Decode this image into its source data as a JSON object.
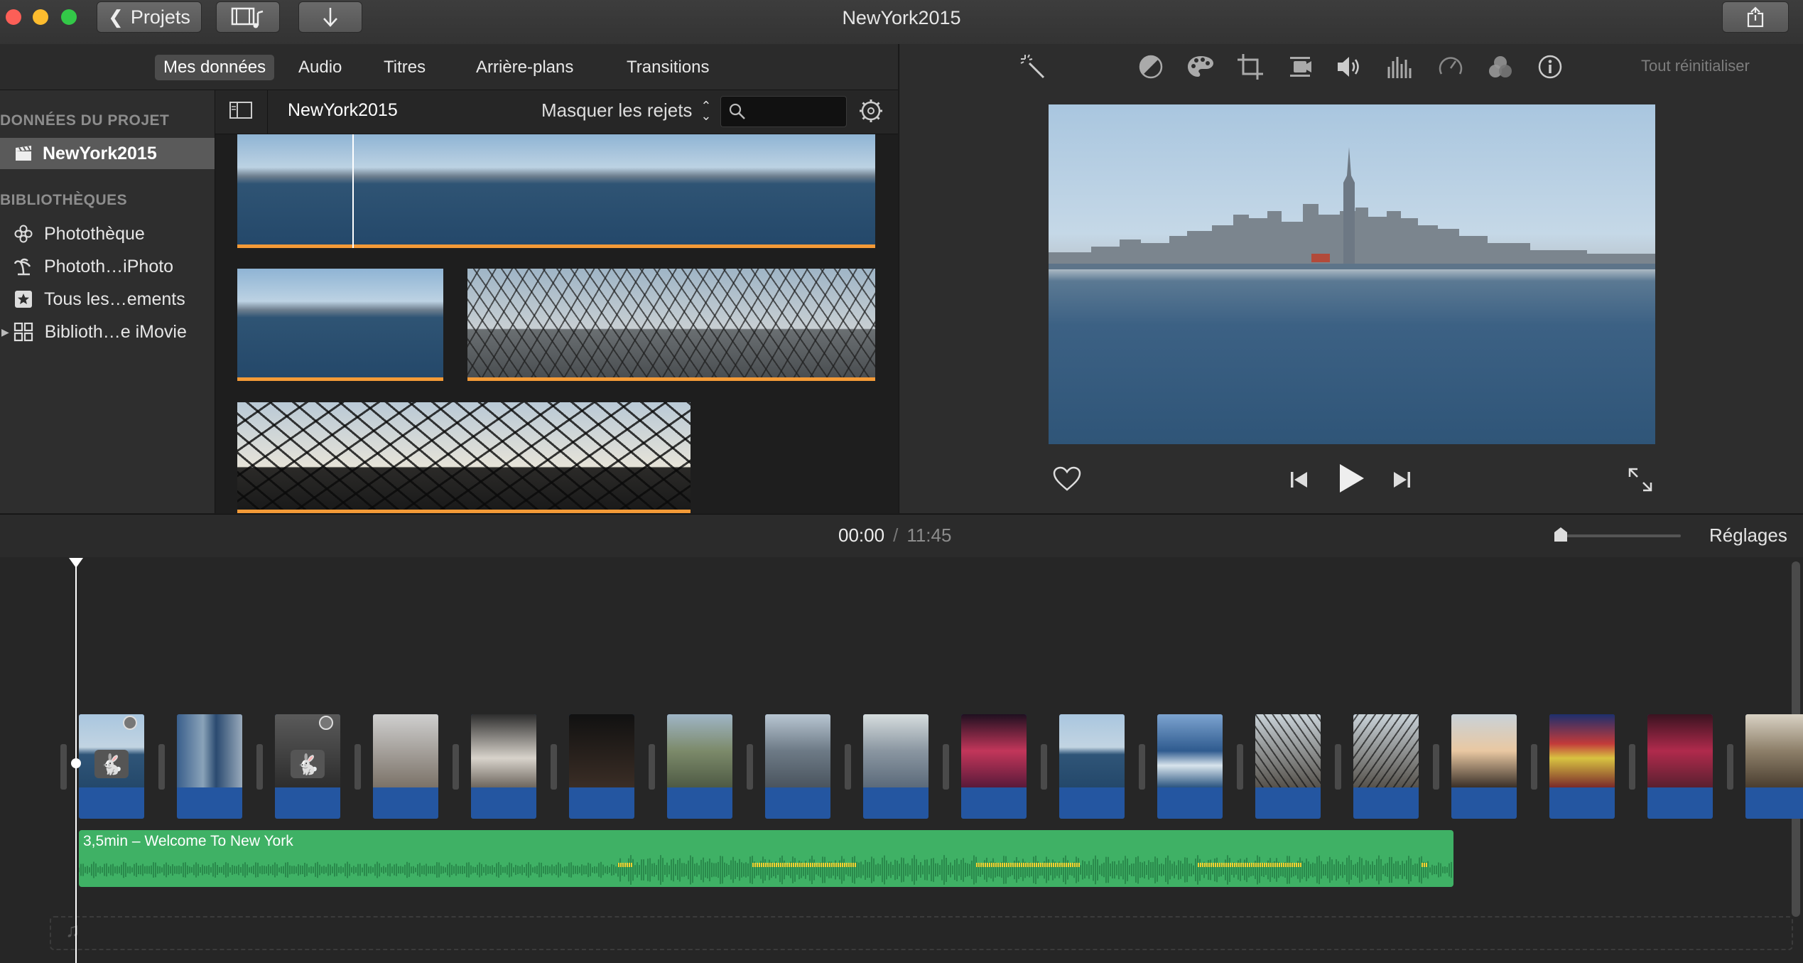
{
  "window": {
    "title": "NewYork2015"
  },
  "toolbar": {
    "projects_label": "Projets",
    "reset_label": "Tout réinitialiser"
  },
  "tabs": [
    {
      "label": "Mes données",
      "active": true
    },
    {
      "label": "Audio"
    },
    {
      "label": "Titres"
    },
    {
      "label": "Arrière-plans"
    },
    {
      "label": "Transitions"
    }
  ],
  "sidebar": {
    "project_header": "DONNÉES DU PROJET",
    "project_item": "NewYork2015",
    "libraries_header": "BIBLIOTHÈQUES",
    "libraries": [
      {
        "label": "Photothèque",
        "icon": "photos-icon"
      },
      {
        "label": "Phototh…iPhoto",
        "icon": "iphoto-icon"
      },
      {
        "label": "Tous les…ements",
        "icon": "star-icon"
      },
      {
        "label": "Biblioth…e iMovie",
        "icon": "grid-icon"
      }
    ]
  },
  "browser": {
    "title": "NewYork2015",
    "filter_label": "Masquer les rejets",
    "search_placeholder": ""
  },
  "timecode": {
    "current": "00:00",
    "separator": "/",
    "total": "11:45"
  },
  "timeline": {
    "settings_label": "Réglages",
    "audio_label": "3,5min – Welcome To New York",
    "clip_count": 18
  },
  "colors": {
    "audio": "#3fb165",
    "clip_audio": "#2456a1",
    "clip_bar": "#f39a37"
  }
}
